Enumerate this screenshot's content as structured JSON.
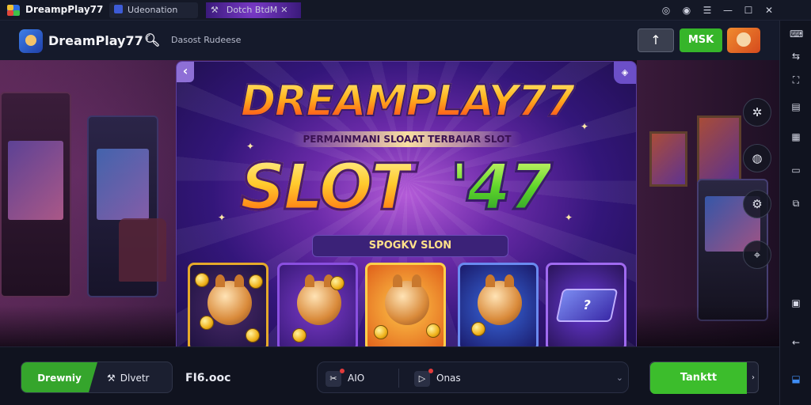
{
  "titlebar": {
    "app_name": "DreampPlay77",
    "tabs": [
      {
        "label": "Udeonation",
        "icon": "app-icon"
      },
      {
        "label": "Dotch BtdM",
        "icon": "close-icon"
      }
    ],
    "controls": [
      "help-icon",
      "settings-icon",
      "menu-icon",
      "minimize-icon",
      "maximize-icon",
      "close-icon"
    ]
  },
  "header": {
    "title": "DreamPlay77",
    "search_icon": "search-icon",
    "search_text": "Dasost Rudeese",
    "upload_glyph": "↑",
    "green_button": "MSK",
    "avatar": "avatar"
  },
  "banner": {
    "title": "DREAMPLAY77",
    "subtitle": "PERMAINMANI SLOAAT TERBAIAR SLOT",
    "slot_word": "SLOT",
    "slot_number": "'47",
    "pill": "SPOGKV SLON",
    "back_glyph": "‹",
    "tiles": [
      "coin-dog-tile",
      "party-dog-tile",
      "gold-dog-tile",
      "blue-dog-tile",
      "mystery-box-tile"
    ],
    "box_label": "?"
  },
  "floating_buttons": [
    "settings-icon",
    "globe-icon",
    "gear-icon",
    "share-icon"
  ],
  "right_sidebar": [
    "keyboard-icon",
    "expand-icon",
    "resize-icon",
    "volume-icon",
    "screenshot-icon",
    "rotate-icon",
    "copy-icon",
    "back-icon",
    "home-icon"
  ],
  "bottombar": {
    "segment_green": "Drewniy",
    "segment_right": "Dlvetr",
    "price": "FI6.ooc",
    "mid_left": "AIO",
    "mid_right": "Onas",
    "cta": "Tanktt"
  },
  "colors": {
    "accent_green": "#3cbd2c",
    "banner_purple": "#6a2aa8",
    "gold": "#ffcb2e"
  }
}
